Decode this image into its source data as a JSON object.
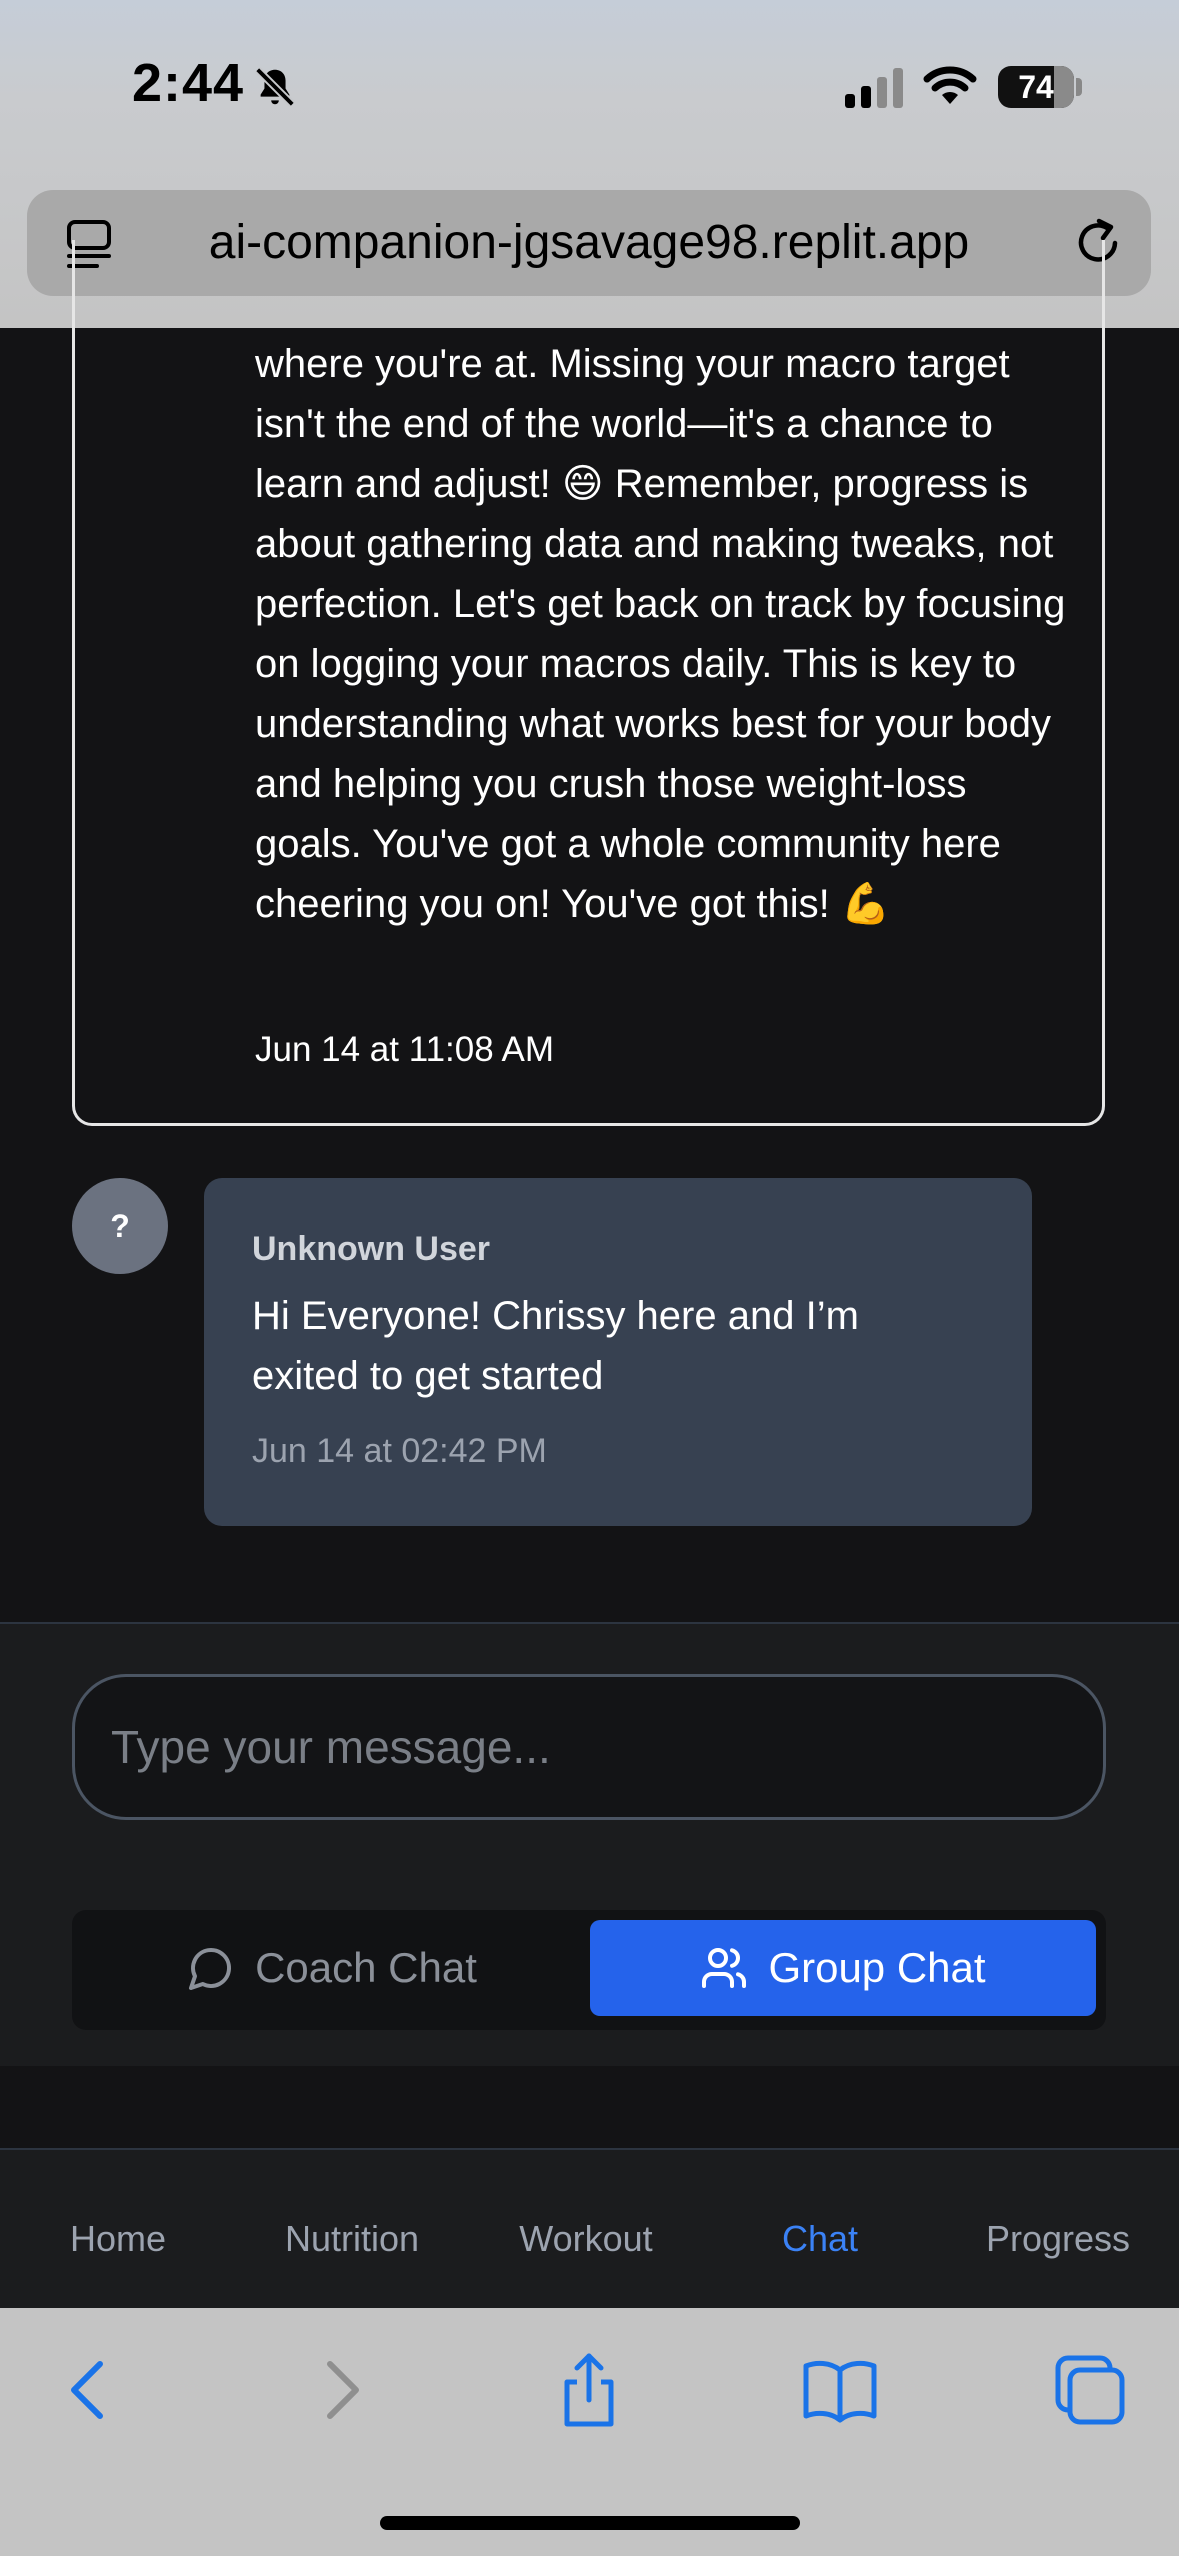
{
  "status_bar": {
    "time": "2:44",
    "battery": "74",
    "icons": [
      "bell-slash-icon",
      "cellular-signal-icon",
      "wifi-icon",
      "battery-icon"
    ]
  },
  "browser": {
    "url": "ai-companion-jgsavage98.replit.app",
    "icons": [
      "tab-overview-icon",
      "reload-icon"
    ]
  },
  "messages": [
    {
      "sender": "coach",
      "text": "where you're at. Missing your macro target isn't the end of the world—it's a chance to learn and adjust! 😄 Remember, progress is about gathering data and making tweaks, not perfection. Let's get back on track by focusing on logging your macros daily. This is key to understanding what works best for your body and helping you crush those weight-loss goals. You've got a whole community here cheering you on! You've got this! 💪",
      "time": "Jun 14 at 11:08 AM"
    },
    {
      "sender": "Unknown User",
      "avatar": "?",
      "text": "Hi Everyone! Chrissy here and I’m exited to get started",
      "time": "Jun 14 at 02:42 PM"
    }
  ],
  "composer": {
    "placeholder": "Type your message..."
  },
  "chat_modes": [
    {
      "label": "Coach Chat",
      "icon": "chat-bubble-icon",
      "active": false
    },
    {
      "label": "Group Chat",
      "icon": "users-icon",
      "active": true
    }
  ],
  "bottom_nav": [
    {
      "label": "Home",
      "active": false
    },
    {
      "label": "Nutrition",
      "active": false
    },
    {
      "label": "Workout",
      "active": false
    },
    {
      "label": "Chat",
      "active": true
    },
    {
      "label": "Progress",
      "active": false
    }
  ],
  "safari_toolbar": [
    "back-icon",
    "forward-icon",
    "share-icon",
    "bookmarks-icon",
    "tabs-icon"
  ],
  "colors": {
    "accent": "#2563eb",
    "nav_active": "#3b82f6",
    "safari_blue": "#1a73e8",
    "user_bubble": "#374151",
    "background": "#131315"
  }
}
